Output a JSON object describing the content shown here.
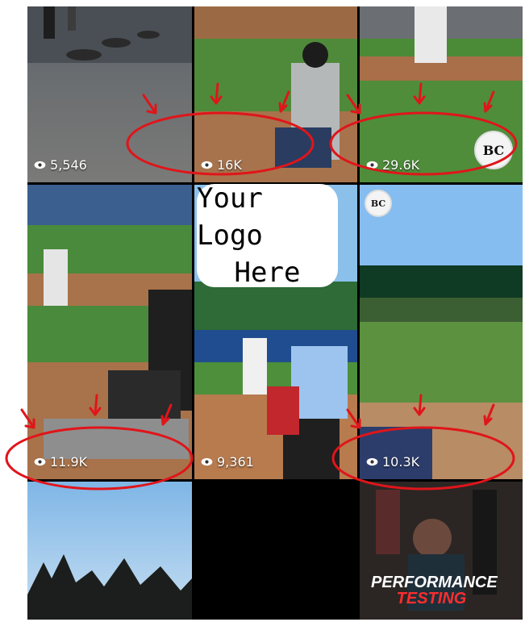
{
  "tiles": [
    {
      "views": "5,546"
    },
    {
      "views": "16K"
    },
    {
      "views": "29.6K"
    },
    {
      "views": "11.9K"
    },
    {
      "views": "9,361"
    },
    {
      "views": "10.3K"
    }
  ],
  "logo_card": {
    "line1": "Your Logo",
    "line2": "Here"
  },
  "badge": {
    "text": "BC"
  },
  "promo": {
    "line1": "PERFORMANCE",
    "line2": "TESTING"
  },
  "colors": {
    "annotation": "#e0151a",
    "frame": "#000000"
  },
  "icons": {
    "views": "eye-icon"
  }
}
